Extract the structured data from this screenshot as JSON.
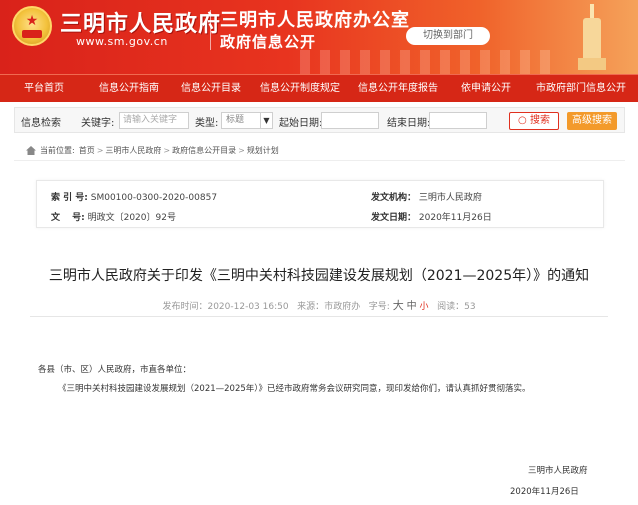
{
  "header": {
    "site_title": "三明市人民政府",
    "site_url": "www.sm.gov.cn",
    "office_title": "三明市人民政府办公室",
    "office_subtitle": "政府信息公开",
    "switch_dept": "切换到部门"
  },
  "nav": {
    "items": [
      {
        "label": "平台首页"
      },
      {
        "label": "信息公开指南"
      },
      {
        "label": "信息公开目录"
      },
      {
        "label": "信息公开制度规定"
      },
      {
        "label": "信息公开年度报告"
      },
      {
        "label": "依申请公开"
      },
      {
        "label": "市政府部门信息公开"
      }
    ]
  },
  "search": {
    "section_label": "信息检索",
    "keyword_label": "关键字:",
    "keyword_placeholder": "请输入关键字",
    "type_label": "类型:",
    "type_value": "标题",
    "start_date_label": "起始日期:",
    "start_date_value": "",
    "end_date_label": "结束日期:",
    "end_date_value": "",
    "search_button": "搜索",
    "advanced_button": "高级搜索"
  },
  "breadcrumb": {
    "current_label": "当前位置:",
    "items": [
      "首页",
      "三明市人民政府",
      "政府信息公开目录",
      "规划计划"
    ],
    "separator": ">"
  },
  "meta": {
    "index_key": "索 引 号:",
    "index_value": "SM00100-0300-2020-00857",
    "issuer_key": "发文机构：",
    "issuer_value": "三明市人民政府",
    "docno_key": "文　 号:",
    "docno_value": "明政文〔2020〕92号",
    "date_key": "发文日期：",
    "date_value": "2020年11月26日"
  },
  "article": {
    "title": "三明市人民政府关于印发《三明中关村科技园建设发展规划（2021—2025年）》的通知",
    "published_label": "发布时间：",
    "published_value": "2020-12-03 16:50",
    "source_label": "来源：",
    "source_value": "市政府办",
    "font_label": "字号:",
    "font_large": "大",
    "font_medium": "中",
    "font_small": "小",
    "views_label": "阅读：",
    "views_value": "53",
    "salutation": "各县（市、区）人民政府，市直各单位：",
    "body": "《三明中关村科技园建设发展规划（2021—2025年）》已经市政府常务会议研究同意，现印发给你们，请认真抓好贯彻落实。",
    "signature_org": "三明市人民政府",
    "signature_date": "2020年11月26日"
  },
  "colors": {
    "brand_red": "#d62716",
    "accent_orange": "#f39a2b",
    "search_red": "#e0301f"
  }
}
